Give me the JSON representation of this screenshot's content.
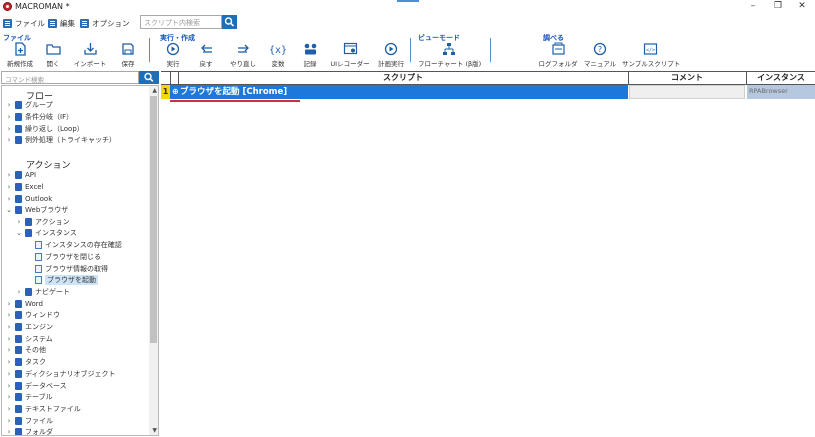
{
  "window": {
    "title": "MACROMAN *",
    "minimize": "–",
    "maximize": "❐",
    "close": "✕"
  },
  "menu": [
    {
      "label": "ファイル"
    },
    {
      "label": "編集"
    },
    {
      "label": "オプション"
    }
  ],
  "script_search": {
    "placeholder": "スクリプト内検索"
  },
  "ribbon": {
    "groups": {
      "file": "ファイル",
      "run": "実行・作成",
      "view": "ビューモード",
      "research": "調べる"
    },
    "tools": {
      "new": "新規作成",
      "open": "開く",
      "import": "インポート",
      "save": "保存",
      "run": "実行",
      "undo": "戻す",
      "redo": "やり直し",
      "variable": "変数",
      "record": "記録",
      "ui_recorder": "UIレコーダー",
      "scheduled_run": "計画実行",
      "flowchart": "フローチャート (β版)",
      "log_folder": "ログフォルダ",
      "manual": "マニュアル",
      "sample_script": "サンプルスクリプト"
    }
  },
  "command_search": {
    "placeholder": "コマンド検索"
  },
  "tree": {
    "flow_title": "フロー",
    "flow_items": [
      "グループ",
      "条件分岐（IF）",
      "繰り返し（Loop）",
      "例外処理（トライキャッチ）"
    ],
    "action_title": "アクション",
    "action_items_top": [
      "API",
      "Excel",
      "Outlook",
      "Webブラウザ"
    ],
    "web_children": {
      "action": "アクション",
      "instance": "インスタンス"
    },
    "instance_children": [
      "インスタンスの存在確認",
      "ブラウザを閉じる",
      "ブラウザ情報の取得",
      "ブラウザを起動"
    ],
    "navigate": "ナビゲート",
    "action_items_bottom": [
      "Word",
      "ウィンドウ",
      "エンジン",
      "システム",
      "その他",
      "タスク",
      "ディクショナリオブジェクト",
      "データベース",
      "テーブル",
      "テキストファイル",
      "ファイル",
      "フォルダ"
    ]
  },
  "grid": {
    "headers": {
      "script": "スクリプト",
      "comment": "コメント",
      "instance": "インスタンス"
    },
    "rows": [
      {
        "number": "1",
        "script": "ブラウザを起動 [Chrome]",
        "comment": "",
        "instance": "RPABrowser"
      }
    ]
  },
  "colors": {
    "accent": "#1c79db",
    "group_label": "#1a55b4",
    "row_number": "#f5d800"
  }
}
